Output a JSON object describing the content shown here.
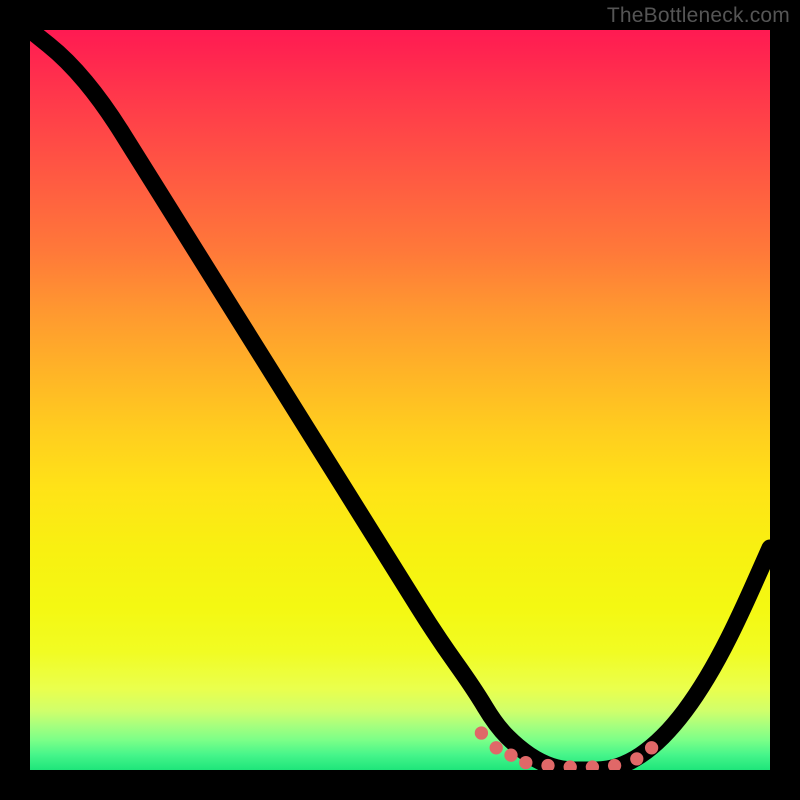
{
  "watermark": "TheBottleneck.com",
  "chart_data": {
    "type": "line",
    "title": "",
    "xlabel": "",
    "ylabel": "",
    "xlim": [
      0,
      100
    ],
    "ylim": [
      0,
      100
    ],
    "grid": false,
    "series": [
      {
        "name": "bottleneck-curve",
        "x": [
          0,
          5,
          10,
          15,
          20,
          25,
          30,
          35,
          40,
          45,
          50,
          55,
          60,
          63,
          66,
          69,
          72,
          75,
          78,
          81,
          84,
          87,
          90,
          93,
          96,
          100
        ],
        "y": [
          100,
          96,
          90,
          82,
          74,
          66,
          58,
          50,
          42,
          34,
          26,
          18,
          11,
          6,
          3,
          1,
          0,
          0,
          0,
          1,
          3,
          6,
          10,
          15,
          21,
          30
        ]
      }
    ],
    "markers": {
      "name": "highlight-dots",
      "x": [
        61,
        63,
        65,
        67,
        70,
        73,
        76,
        79,
        82,
        84
      ],
      "y": [
        5,
        3,
        2,
        1,
        0.6,
        0.4,
        0.4,
        0.6,
        1.5,
        3
      ]
    },
    "background": {
      "type": "vertical-gradient",
      "stops": [
        {
          "pos": 0.0,
          "color": "#ff1a52"
        },
        {
          "pos": 0.38,
          "color": "#ff9830"
        },
        {
          "pos": 0.62,
          "color": "#ffe317"
        },
        {
          "pos": 0.84,
          "color": "#f1fc23"
        },
        {
          "pos": 1.0,
          "color": "#1ee57a"
        }
      ]
    }
  }
}
